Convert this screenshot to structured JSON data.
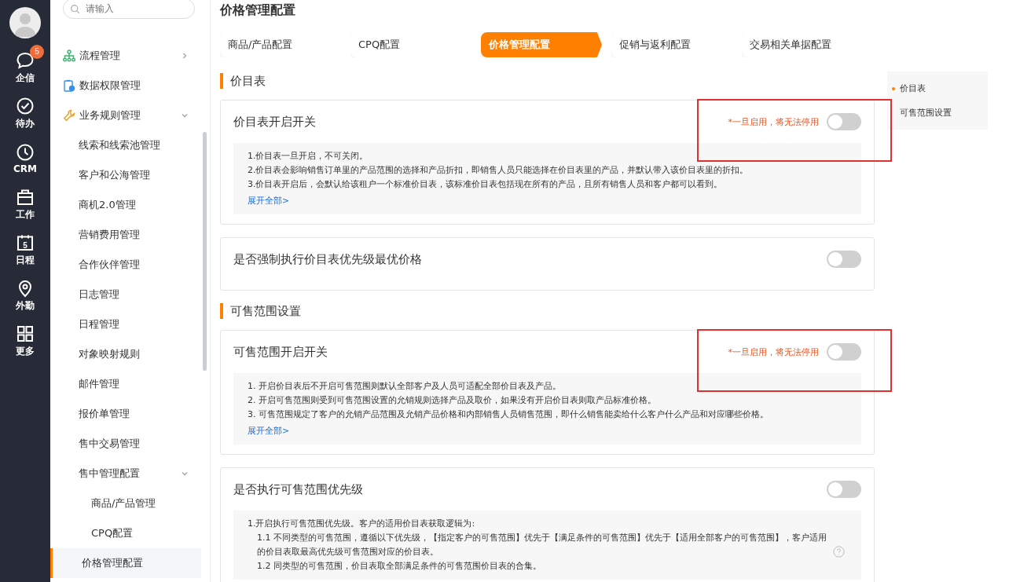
{
  "rail": {
    "items": [
      {
        "kind": "chat",
        "label": "企信",
        "badge": "5"
      },
      {
        "kind": "check",
        "label": "待办"
      },
      {
        "kind": "clock",
        "label": "CRM"
      },
      {
        "kind": "briefcase",
        "label": "工作"
      },
      {
        "kind": "calendar",
        "label": "日程",
        "date": "5"
      },
      {
        "kind": "pin",
        "label": "外勤"
      },
      {
        "kind": "grid",
        "label": "更多"
      }
    ]
  },
  "sidebar": {
    "search": {
      "placeholder": "请输入"
    },
    "items": [
      {
        "label": "流程管理",
        "kind": "flow",
        "expanded": false,
        "selected": false
      },
      {
        "label": "数据权限管理",
        "kind": "data",
        "selected": false
      },
      {
        "label": "业务规则管理",
        "kind": "wrench",
        "expanded": true,
        "selected": false,
        "children": [
          {
            "label": "线索和线索池管理",
            "selected": false
          },
          {
            "label": "客户和公海管理",
            "selected": false
          },
          {
            "label": "商机2.0管理",
            "selected": false
          },
          {
            "label": "营销费用管理",
            "selected": false
          },
          {
            "label": "合作伙伴管理",
            "selected": false
          },
          {
            "label": "日志管理",
            "selected": false
          },
          {
            "label": "日程管理",
            "selected": false
          },
          {
            "label": "对象映射规则",
            "selected": false
          },
          {
            "label": "邮件管理",
            "selected": false
          },
          {
            "label": "报价单管理",
            "selected": false
          },
          {
            "label": "售中交易管理",
            "selected": false
          },
          {
            "label": "售中管理配置",
            "selected": false,
            "expanded": true,
            "children": [
              {
                "label": "商品/产品管理",
                "selected": false
              },
              {
                "label": "CPQ配置",
                "selected": false
              },
              {
                "label": "价格管理配置",
                "selected": true
              }
            ]
          }
        ]
      }
    ]
  },
  "main": {
    "title": "价格管理配置",
    "tabs": [
      {
        "label": "商品/产品配置",
        "selected": false
      },
      {
        "label": "CPQ配置",
        "selected": false
      },
      {
        "label": "价格管理配置",
        "selected": true
      },
      {
        "label": "促销与返利配置",
        "selected": false
      },
      {
        "label": "交易相关单据配置",
        "selected": false
      }
    ],
    "toc": [
      {
        "label": "价目表",
        "selected": true
      },
      {
        "label": "可售范围设置",
        "selected": false
      }
    ],
    "sections": [
      {
        "heading": "价目表",
        "cards": [
          {
            "title": "价目表开启开关",
            "warning": "*一旦启用，将无法停用",
            "highlighted": true,
            "on": false,
            "notes": [
              {
                "text": "1.价目表一旦开启，不可关闭。"
              },
              {
                "text": "2.价目表会影响销售订单里的产品范围的选择和产品折扣，即销售人员只能选择在价目表里的产品，并默认带入该价目表里的折扣。"
              },
              {
                "text": "3.价目表开启后，会默认给该租户一个标准价目表，该标准价目表包括现在所有的产品，且所有销售人员和客户都可以看到。"
              }
            ],
            "link": "展开全部>"
          },
          {
            "title": "是否强制执行价目表优先级最优价格",
            "highlighted": false,
            "on": false
          }
        ]
      },
      {
        "heading": "可售范围设置",
        "cards": [
          {
            "title": "可售范围开启开关",
            "warning": "*一旦启用，将无法停用",
            "highlighted": true,
            "on": false,
            "notes": [
              {
                "text": "1. 开启价目表后不开启可售范围则默认全部客户及人员可适配全部价目表及产品。"
              },
              {
                "text": "2. 开启可售范围则受到可售范围设置的允销规则选择产品及取价，如果没有开启价目表则取产品标准价格。"
              },
              {
                "text": "3. 可售范围规定了客户的允销产品范围及允销产品价格和内部销售人员销售范围，即什么销售能卖给什么客户什么产品和对应哪些价格。"
              }
            ],
            "link": "展开全部>"
          },
          {
            "title": "是否执行可售范围优先级",
            "highlighted": false,
            "on": false,
            "notes": [
              {
                "text": "1.开启执行可售范围优先级。客户的适用价目表获取逻辑为:",
                "children": [
                  {
                    "text": "1.1 不同类型的可售范围，遵循以下优先级，【指定客户的可售范围】优先于【满足条件的可售范围】优先于【适用全部客户的可售范围】，客户适用的价目表取最高优先级可售范围对应的价目表。",
                    "help": true
                  },
                  {
                    "text": "1.2 同类型的可售范围，价目表取全部满足条件的可售范围价目表的合集。",
                    "help": false
                  }
                ]
              }
            ]
          }
        ]
      }
    ]
  }
}
